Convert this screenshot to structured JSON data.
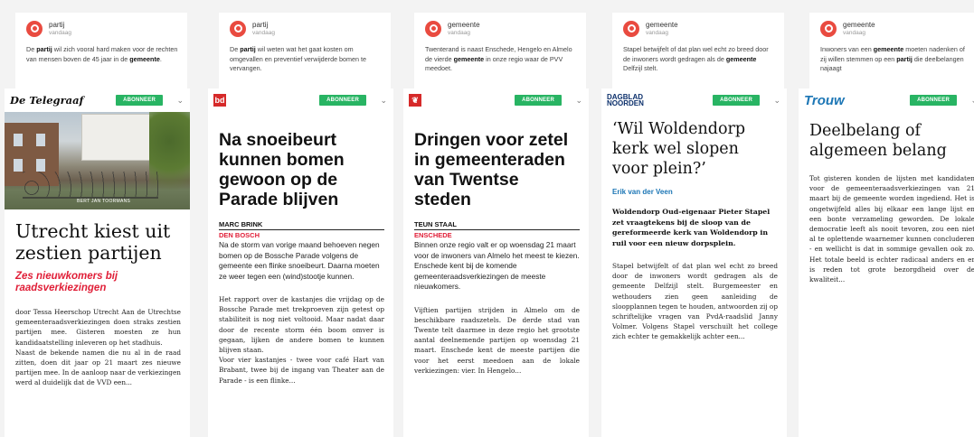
{
  "columns": [
    {
      "snippet": {
        "keyword": "partij",
        "date": "vandaag",
        "text_parts": [
          "De ",
          "partij",
          " wil zich vooral hard maken voor de rechten van mensen boven de 45 jaar in de ",
          "gemeente",
          "."
        ]
      },
      "card": {
        "logo": "De Telegraaf",
        "subscribe": "ABONNEER",
        "photo_credit": "BERT JAN TOORMANS",
        "headline": "Utrecht kiest uit zestien partijen",
        "subheadline": "Zes nieuwkomers bij raadsverkiezingen",
        "body": [
          "door Tessa Heerschop Utrecht Aan de Utrechtse gemeenteraadsverkiezingen doen straks zestien partijen mee. Gisteren moesten ze hun kandidaatstelling inleveren op het stadhuis.",
          "Naast de bekende namen die nu al in de raad zitten, doen dit jaar op 21 maart zes nieuwe partijen mee. In de aanloop naar de verkiezingen werd al duidelijk dat de VVD een..."
        ]
      }
    },
    {
      "snippet": {
        "keyword": "partij",
        "date": "vandaag",
        "text_parts": [
          "De ",
          "partij",
          " wil weten wat het gaat kosten om omgevallen en preventief verwijderde bomen te vervangen."
        ]
      },
      "card": {
        "logo": "bd",
        "subscribe": "ABONNEER",
        "headline": "Na snoeibeurt kunnen bomen gewoon op de Parade blijven",
        "author": "MARC BRINK",
        "location": "DEN BOSCH",
        "intro": "Na de storm van vorige maand behoeven negen bomen op de Bossche Parade volgens de gemeente een flinke snoeibeurt. Daarna moeten ze weer tegen een (wind)stootje kunnen.",
        "body": [
          "Het rapport over de kastanjes die vrijdag op de Bossche Parade met trekproeven zijn getest op stabiliteit is nog niet voltooid. Maar nadat daar door de recente storm één boom omver is gegaan, lijken de andere bomen te kunnen blijven staan.",
          "Voor vier kastanjes - twee voor café Hart van Brabant, twee bij de ingang van Theater aan de Parade - is een flinke..."
        ]
      }
    },
    {
      "snippet": {
        "keyword": "gemeente",
        "date": "vandaag",
        "text_parts": [
          "Twenterand is naast Enschede, Hengelo en Almelo de vierde ",
          "gemeente",
          " in onze regio waar de PVV meedoet."
        ]
      },
      "card": {
        "logo": "tubantia",
        "subscribe": "ABONNEER",
        "headline": "Dringen voor zetel in gemeenteraden van Twentse steden",
        "author": "TEUN STAAL",
        "location": "ENSCHEDE",
        "intro": "Binnen onze regio valt er op woensdag 21 maart voor de inwoners van Almelo het meest te kiezen. Enschede kent bij de komende gemeenteraadsverkiezingen de meeste nieuwkomers.",
        "body": [
          "Vijftien partijen strijden in Almelo om de beschikbare raadszetels. De derde stad van Twente telt daarmee in deze regio het grootste aantal deelnemende partijen op woensdag 21 maart. Enschede kent de meeste partijen die voor het eerst meedoen aan de lokale verkiezingen: vier. In Hengelo..."
        ]
      }
    },
    {
      "snippet": {
        "keyword": "gemeente",
        "date": "vandaag",
        "text_parts": [
          "Stapel betwijfelt of dat plan wel echt zo breed door de inwoners wordt gedragen als de ",
          "gemeente",
          " Delfzijl stelt."
        ]
      },
      "card": {
        "logo_line1": "DAGBLAD",
        "logo_line2": "NOORDEN",
        "subscribe": "ABONNEER",
        "headline": "‘Wil Woldendorp kerk wel slopen voor plein?’",
        "author": "Erik van der Veen",
        "lead": "Woldendorp Oud-eigenaar Pieter Stapel zet vraagtekens bij de sloop van de gereformeerde kerk van Woldendorp in ruil voor een nieuw dorpsplein.",
        "body": [
          "Stapel betwijfelt of dat plan wel echt zo breed door de inwoners wordt gedragen als de gemeente Delfzijl stelt. Burgemeester en wethouders zien geen aanleiding de sloopplannen tegen te houden, antwoorden zij op schriftelijke vragen van PvdA-raadslid Janny Volmer. Volgens Stapel verschuilt het college zich echter te gemakkelijk achter een..."
        ]
      }
    },
    {
      "snippet": {
        "keyword": "gemeente",
        "date": "vandaag",
        "text_parts": [
          "Inwoners van een ",
          "gemeente",
          " moeten nadenken of zij willen stemmen op een ",
          "partij",
          " die deelbelangen najaagt"
        ]
      },
      "card": {
        "logo": "Trouw",
        "subscribe": "ABONNEER",
        "headline": "Deelbelang of algemeen belang",
        "body": [
          "Tot gisteren konden de lijsten met kandidaten voor de gemeenteraadsverkiezingen van 21 maart bij de gemeente worden ingediend. Het is ongetwijfeld alles bij elkaar een lange lijst en een bonte verzameling geworden. De lokale democratie leeft als nooit tevoren, zou een niet al te oplettende waarnemer kunnen concluderen - en wellicht is dat in sommige gevallen ook zo. Het totale beeld is echter radicaal anders en er is reden tot grote bezorgdheid over de kwaliteit..."
        ]
      }
    }
  ],
  "colors": {
    "accent_red": "#e01e37",
    "subscribe_green": "#28b463",
    "pin_red": "#e94b40",
    "trouw_blue": "#1c76b5",
    "dvhn_navy": "#0b2f6b"
  },
  "icons": [
    "pin-icon",
    "chevron-down-icon"
  ]
}
